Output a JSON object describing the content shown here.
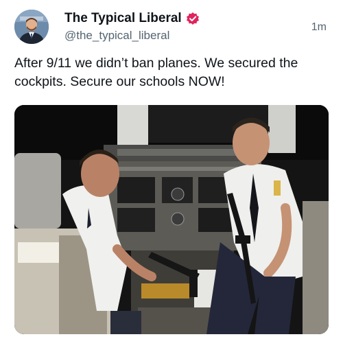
{
  "author": {
    "display_name": "The Typical Liberal",
    "handle": "@the_typical_liberal",
    "avatar_icon": "avatar-man-suit-icon",
    "verified_icon": "verified-badge-icon",
    "verified_color": "#e0245e"
  },
  "timestamp": "1m",
  "post": {
    "text": "After 9/11 we didn’t ban planes. We secured the cockpits. Secure our schools NOW!"
  },
  "media": {
    "type": "photo"
  },
  "colors": {
    "text": "#0f1419",
    "secondary": "#536471",
    "background": "#ffffff"
  }
}
